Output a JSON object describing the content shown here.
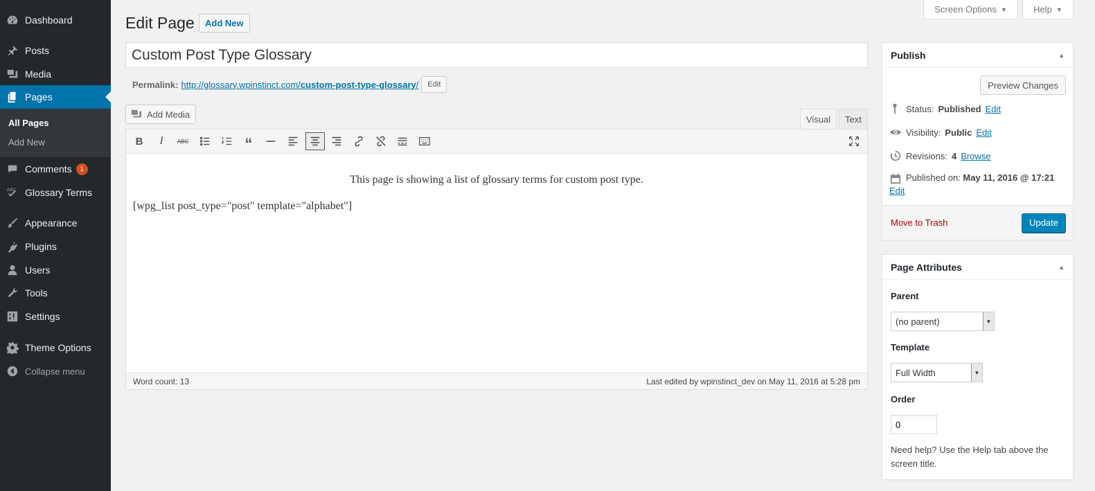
{
  "sidebar": {
    "items": [
      {
        "label": "Dashboard",
        "icon": "dashboard-icon"
      },
      {
        "label": "Posts",
        "icon": "pin-icon"
      },
      {
        "label": "Media",
        "icon": "media-icon"
      },
      {
        "label": "Pages",
        "icon": "pages-icon"
      },
      {
        "label": "Comments",
        "icon": "comment-icon",
        "badge": "1"
      },
      {
        "label": "Glossary Terms",
        "icon": "abc-check-icon"
      },
      {
        "label": "Appearance",
        "icon": "brush-icon"
      },
      {
        "label": "Plugins",
        "icon": "plug-icon"
      },
      {
        "label": "Users",
        "icon": "user-icon"
      },
      {
        "label": "Tools",
        "icon": "wrench-icon"
      },
      {
        "label": "Settings",
        "icon": "settings-icon"
      },
      {
        "label": "Theme Options",
        "icon": "gear-icon"
      }
    ],
    "submenu": [
      "All Pages",
      "Add New"
    ],
    "collapse_label": "Collapse menu"
  },
  "top": {
    "screen_options": "Screen Options",
    "help": "Help"
  },
  "header": {
    "title": "Edit Page",
    "add_new": "Add New"
  },
  "post": {
    "title": "Custom Post Type Glossary",
    "permalink_label": "Permalink:",
    "permalink_base": "http://glossary.wpinstinct.com/",
    "permalink_slug": "custom-post-type-glossary",
    "permalink_trail": "/",
    "permalink_edit": "Edit"
  },
  "editor": {
    "add_media": "Add Media",
    "tab_visual": "Visual",
    "tab_text": "Text",
    "content_line1": "This page is showing a list of glossary terms for custom post type.",
    "content_line2": "[wpg_list post_type=\"post\" template=\"alphabet\"]",
    "word_count": "Word count: 13",
    "last_edited": "Last edited by wpinstinct_dev on May 11, 2016 at 5:28 pm"
  },
  "publish": {
    "title": "Publish",
    "preview": "Preview Changes",
    "status_label": "Status:",
    "status_value": "Published",
    "visibility_label": "Visibility:",
    "visibility_value": "Public",
    "revisions_label": "Revisions:",
    "revisions_value": "4",
    "browse": "Browse",
    "published_label": "Published on:",
    "published_value": "May 11, 2016 @ 17:21",
    "edit": "Edit",
    "trash": "Move to Trash",
    "update": "Update"
  },
  "attributes": {
    "title": "Page Attributes",
    "parent_label": "Parent",
    "parent_value": "(no parent)",
    "template_label": "Template",
    "template_value": "Full Width",
    "order_label": "Order",
    "order_value": "0",
    "help": "Need help? Use the Help tab above the screen title."
  }
}
